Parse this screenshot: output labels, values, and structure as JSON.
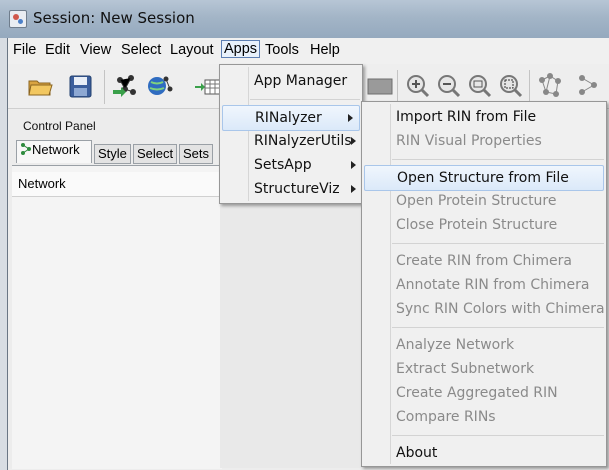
{
  "window": {
    "title": "Session: New Session"
  },
  "menubar": {
    "items": [
      "File",
      "Edit",
      "View",
      "Select",
      "Layout",
      "Apps",
      "Tools",
      "Help"
    ],
    "active": "Apps"
  },
  "toolbar": {
    "icons": [
      "open-session-icon",
      "save-session-icon",
      "import-network-file-icon",
      "import-network-web-icon",
      "import-table-icon",
      "new-network-icon",
      "zoom-in-icon",
      "zoom-out-icon",
      "zoom-fit-icon",
      "zoom-selected-icon",
      "show-graph-icon",
      "layout-icon"
    ]
  },
  "control_panel": {
    "title": "Control Panel",
    "tabs": [
      "Network",
      "Style",
      "Select",
      "Sets"
    ],
    "selected_tab": "Network",
    "network_header": "Network"
  },
  "apps_menu": {
    "items": [
      {
        "label": "App Manager",
        "submenu": false
      },
      {
        "label": "RINalyzer",
        "submenu": true,
        "highlighted": true
      },
      {
        "label": "RINalyzerUtils",
        "submenu": true
      },
      {
        "label": "SetsApp",
        "submenu": true
      },
      {
        "label": "StructureViz",
        "submenu": true
      }
    ]
  },
  "rinalyzer_menu": {
    "items": [
      {
        "label": "Import RIN from File",
        "enabled": true
      },
      {
        "label": "RIN Visual Properties",
        "enabled": false
      },
      {
        "label": "Open Structure from File",
        "enabled": true,
        "highlighted": true
      },
      {
        "label": "Open Protein Structure",
        "enabled": false
      },
      {
        "label": "Close Protein Structure",
        "enabled": false
      },
      {
        "label": "Create RIN from Chimera",
        "enabled": false
      },
      {
        "label": "Annotate RIN from Chimera",
        "enabled": false
      },
      {
        "label": "Sync RIN Colors with Chimera",
        "enabled": false
      },
      {
        "label": "Analyze Network",
        "enabled": false
      },
      {
        "label": "Extract Subnetwork",
        "enabled": false
      },
      {
        "label": "Create Aggregated RIN",
        "enabled": false
      },
      {
        "label": "Compare RINs",
        "enabled": false
      },
      {
        "label": "About",
        "enabled": true
      }
    ]
  },
  "colors": {
    "accent": "#5d7fb3",
    "title_bar": "#a3b5c7"
  }
}
